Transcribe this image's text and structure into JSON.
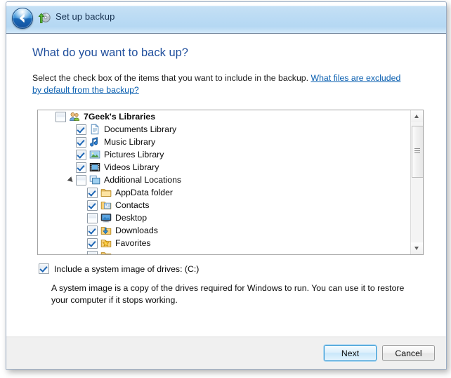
{
  "window": {
    "title": "Set up backup",
    "title_icon": "backup-disc-icon",
    "back_button": "back-arrow-icon"
  },
  "page": {
    "heading": "What do you want to back up?",
    "instruction_text": "Select the check box of the items that you want to include in the backup. ",
    "instruction_link": "What files are excluded by default from the backup?"
  },
  "tree": {
    "items": [
      {
        "label": "7Geek's Libraries",
        "checked": false,
        "icon": "users-library-icon",
        "level": 0,
        "expander": true,
        "bold": true
      },
      {
        "label": "Documents Library",
        "checked": true,
        "icon": "document-icon",
        "level": 1,
        "expander": false,
        "bold": false
      },
      {
        "label": "Music Library",
        "checked": true,
        "icon": "music-note-icon",
        "level": 1,
        "expander": false,
        "bold": false
      },
      {
        "label": "Pictures Library",
        "checked": true,
        "icon": "picture-icon",
        "level": 1,
        "expander": false,
        "bold": false
      },
      {
        "label": "Videos Library",
        "checked": true,
        "icon": "film-strip-icon",
        "level": 1,
        "expander": false,
        "bold": false
      },
      {
        "label": "Additional Locations",
        "checked": false,
        "icon": "folders-stack-icon",
        "level": 1,
        "expander": true,
        "bold": false
      },
      {
        "label": "AppData folder",
        "checked": true,
        "icon": "folder-icon",
        "level": 2,
        "expander": false,
        "bold": false
      },
      {
        "label": "Contacts",
        "checked": true,
        "icon": "contacts-folder-icon",
        "level": 2,
        "expander": false,
        "bold": false
      },
      {
        "label": "Desktop",
        "checked": false,
        "icon": "desktop-icon",
        "level": 2,
        "expander": false,
        "bold": false
      },
      {
        "label": "Downloads",
        "checked": true,
        "icon": "downloads-folder-icon",
        "level": 2,
        "expander": false,
        "bold": false
      },
      {
        "label": "Favorites",
        "checked": true,
        "icon": "favorites-folder-icon",
        "level": 2,
        "expander": false,
        "bold": false
      },
      {
        "label": "",
        "checked": false,
        "icon": "folder-icon",
        "level": 2,
        "expander": false,
        "bold": false
      }
    ],
    "scrollbar": {
      "up_arrow": "scroll-up-icon",
      "down_arrow": "scroll-down-icon",
      "thumb": "scroll-thumb"
    }
  },
  "system_image": {
    "checked": true,
    "label": "Include a system image of drives: (C:)",
    "description": "A system image is a copy of the drives required for Windows to run. You can use it to restore your computer if it stops working."
  },
  "footer": {
    "next_label": "Next",
    "cancel_label": "Cancel"
  },
  "colors": {
    "heading": "#1f4e9c",
    "link": "#0a5fb0",
    "titlebar": "#b5d8f3",
    "accent": "#2e95d3",
    "footer_bg": "#f0f0f0"
  }
}
